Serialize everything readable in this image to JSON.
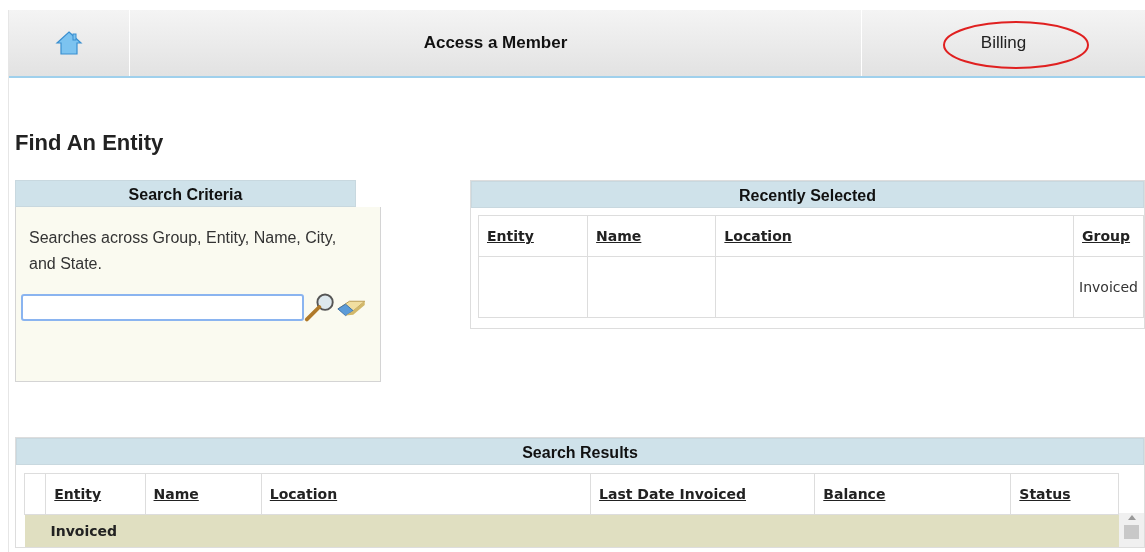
{
  "nav": {
    "title": "Access a Member",
    "billing": "Billing",
    "billing_circled": true
  },
  "heading": "Find An Entity",
  "search_criteria": {
    "title": "Search Criteria",
    "hint": "Searches across Group, Entity, Name, City, and State."
  },
  "recently_selected": {
    "title": "Recently Selected",
    "columns": [
      "Entity",
      "Name",
      "Location",
      "Group"
    ],
    "rows": [
      [
        "",
        "",
        "",
        "Invoiced"
      ]
    ]
  },
  "search_results": {
    "title": "Search Results",
    "columns": [
      "Entity",
      "Name",
      "Location",
      "Last Date Invoiced",
      "Balance",
      "Status"
    ],
    "group_rows": [
      "Invoiced"
    ]
  }
}
